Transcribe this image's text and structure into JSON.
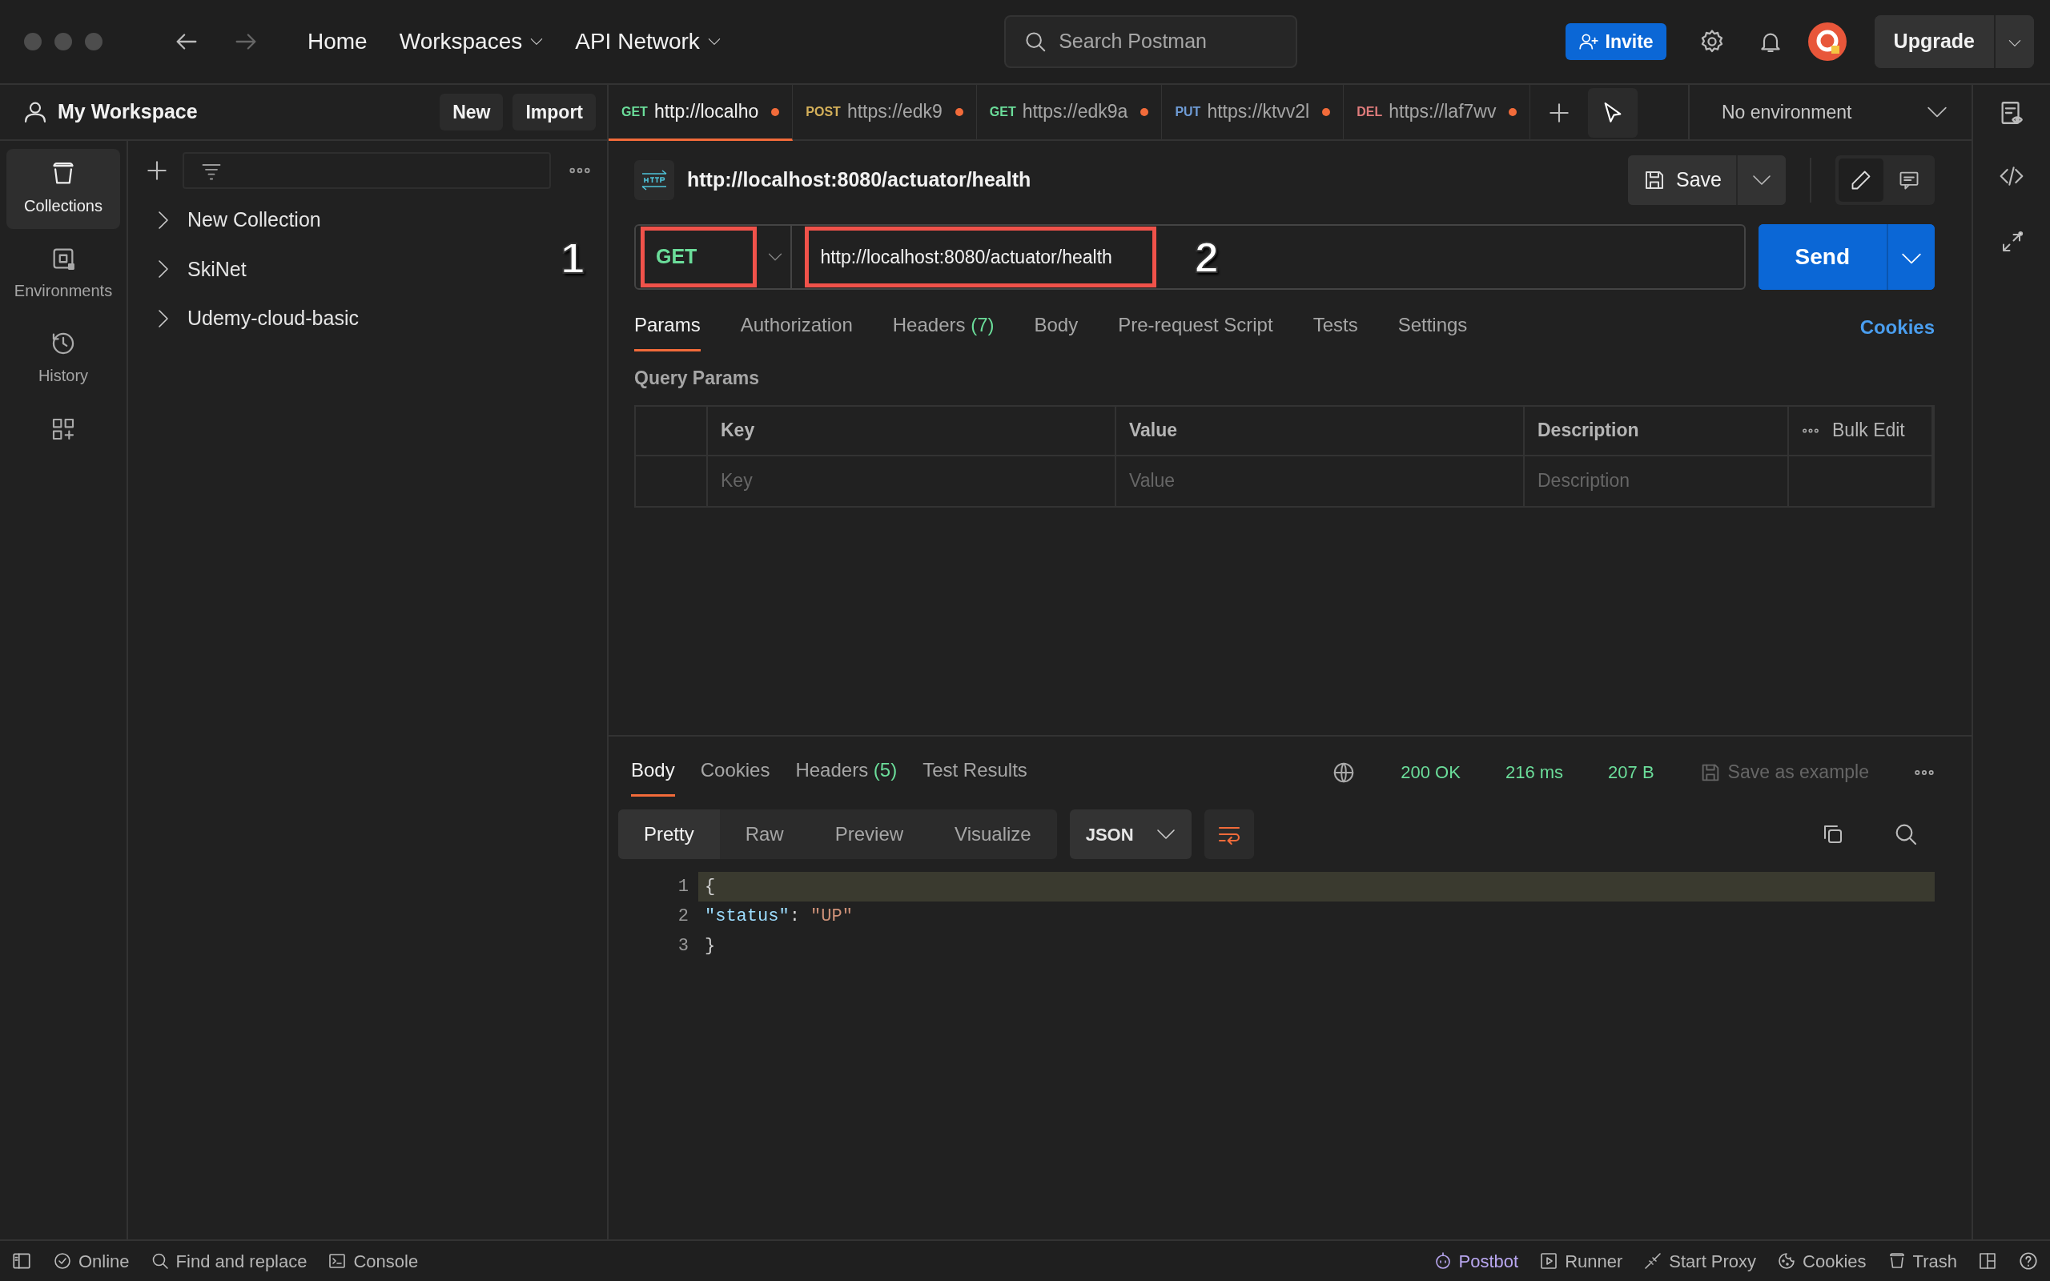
{
  "header": {
    "nav": [
      {
        "label": "Home",
        "dropdown": false
      },
      {
        "label": "Workspaces",
        "dropdown": true
      },
      {
        "label": "API Network",
        "dropdown": true
      }
    ],
    "search": {
      "placeholder": "Search Postman"
    },
    "invite": "Invite",
    "upgrade": "Upgrade"
  },
  "workspace": {
    "title": "My Workspace",
    "buttons": [
      "New",
      "Import"
    ]
  },
  "sidebar": {
    "items": [
      {
        "label": "Collections",
        "kind": "collections",
        "selected": true
      },
      {
        "label": "Environments",
        "kind": "environments",
        "selected": false
      },
      {
        "label": "History",
        "kind": "history",
        "selected": false
      }
    ],
    "collections": [
      {
        "name": "New Collection"
      },
      {
        "name": "SkiNet"
      },
      {
        "name": "Udemy-cloud-basic"
      }
    ]
  },
  "tabs": [
    {
      "method": "GET",
      "color": "#6bdd9a",
      "url": "http://localho",
      "selected": true,
      "unsaved": true
    },
    {
      "method": "POST",
      "color": "#d4b05a",
      "url": "https://edk9",
      "selected": false,
      "unsaved": true
    },
    {
      "method": "GET",
      "color": "#6bdd9a",
      "url": "https://edk9a",
      "selected": false,
      "unsaved": true
    },
    {
      "method": "PUT",
      "color": "#6f9cd6",
      "url": "https://ktvv2l",
      "selected": false,
      "unsaved": true
    },
    {
      "method": "DEL",
      "color": "#e07c7c",
      "url": "https://laf7wv",
      "selected": false,
      "unsaved": true
    }
  ],
  "environment": "No environment",
  "request": {
    "title": "http://localhost:8080/actuator/health",
    "save": "Save",
    "method": {
      "label": "GET",
      "annotation": "1"
    },
    "url": {
      "value": "http://localhost:8080/actuator/health",
      "annotation": "2"
    },
    "send": "Send",
    "tabs": [
      {
        "label": "Params",
        "selected": true
      },
      {
        "label": "Authorization",
        "selected": false
      },
      {
        "label": "Headers",
        "count": "(7)",
        "selected": false
      },
      {
        "label": "Body",
        "selected": false
      },
      {
        "label": "Pre-request Script",
        "selected": false
      },
      {
        "label": "Tests",
        "selected": false
      },
      {
        "label": "Settings",
        "selected": false
      }
    ],
    "cookies": "Cookies",
    "query_title": "Query Params",
    "table": {
      "columns": [
        "Key",
        "Value",
        "Description"
      ],
      "bulk_edit": "Bulk Edit",
      "placeholders": [
        "Key",
        "Value",
        "Description"
      ]
    }
  },
  "response": {
    "tabs": [
      {
        "label": "Body",
        "selected": true
      },
      {
        "label": "Cookies",
        "selected": false
      },
      {
        "label": "Headers",
        "count": "(5)",
        "selected": false
      },
      {
        "label": "Test Results",
        "selected": false
      }
    ],
    "status": "200 OK",
    "time": "216 ms",
    "size": "207 B",
    "save_example": "Save as example",
    "formats": [
      {
        "label": "Pretty",
        "selected": true
      },
      {
        "label": "Raw",
        "selected": false
      },
      {
        "label": "Preview",
        "selected": false
      },
      {
        "label": "Visualize",
        "selected": false
      }
    ],
    "language": "JSON",
    "lines": [
      {
        "number": "1",
        "highlighted": true,
        "tokens": [
          {
            "kind": "punct",
            "text": "{"
          }
        ]
      },
      {
        "number": "2",
        "highlighted": false,
        "tokens": [
          {
            "kind": "key",
            "text": "\"status\""
          },
          {
            "kind": "punct",
            "text": ": "
          },
          {
            "kind": "string",
            "text": "\"UP\""
          }
        ]
      },
      {
        "number": "3",
        "highlighted": false,
        "tokens": [
          {
            "kind": "punct",
            "text": "}"
          }
        ]
      }
    ]
  },
  "status_bar": {
    "left": [
      {
        "label": "Online",
        "kind": "online"
      },
      {
        "label": "Find and replace",
        "kind": "find"
      },
      {
        "label": "Console",
        "kind": "console"
      }
    ],
    "right": [
      {
        "label": "Postbot",
        "kind": "postbot"
      },
      {
        "label": "Runner",
        "kind": "runner"
      },
      {
        "label": "Start Proxy",
        "kind": "proxy"
      },
      {
        "label": "Cookies",
        "kind": "cookies"
      },
      {
        "label": "Trash",
        "kind": "trash"
      }
    ]
  }
}
